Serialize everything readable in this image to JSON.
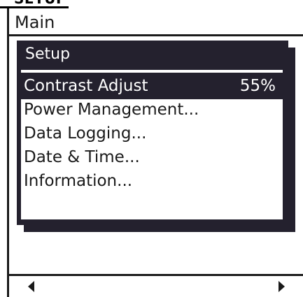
{
  "top_tab": {
    "label": "SETUP"
  },
  "main": {
    "title": "Main"
  },
  "dialog": {
    "title": "Setup",
    "items": [
      {
        "label": "Contrast Adjust",
        "value": "55%",
        "selected": true
      },
      {
        "label": "Power Management..."
      },
      {
        "label": "Data Logging..."
      },
      {
        "label": "Date & Time..."
      },
      {
        "label": "Information..."
      }
    ]
  },
  "scroll": {
    "left_icon": "triangle-left-icon",
    "right_icon": "triangle-right-icon"
  },
  "colors": {
    "dialog_bg": "#24212e",
    "text": "#1a1a1a",
    "background": "#ffffff"
  }
}
